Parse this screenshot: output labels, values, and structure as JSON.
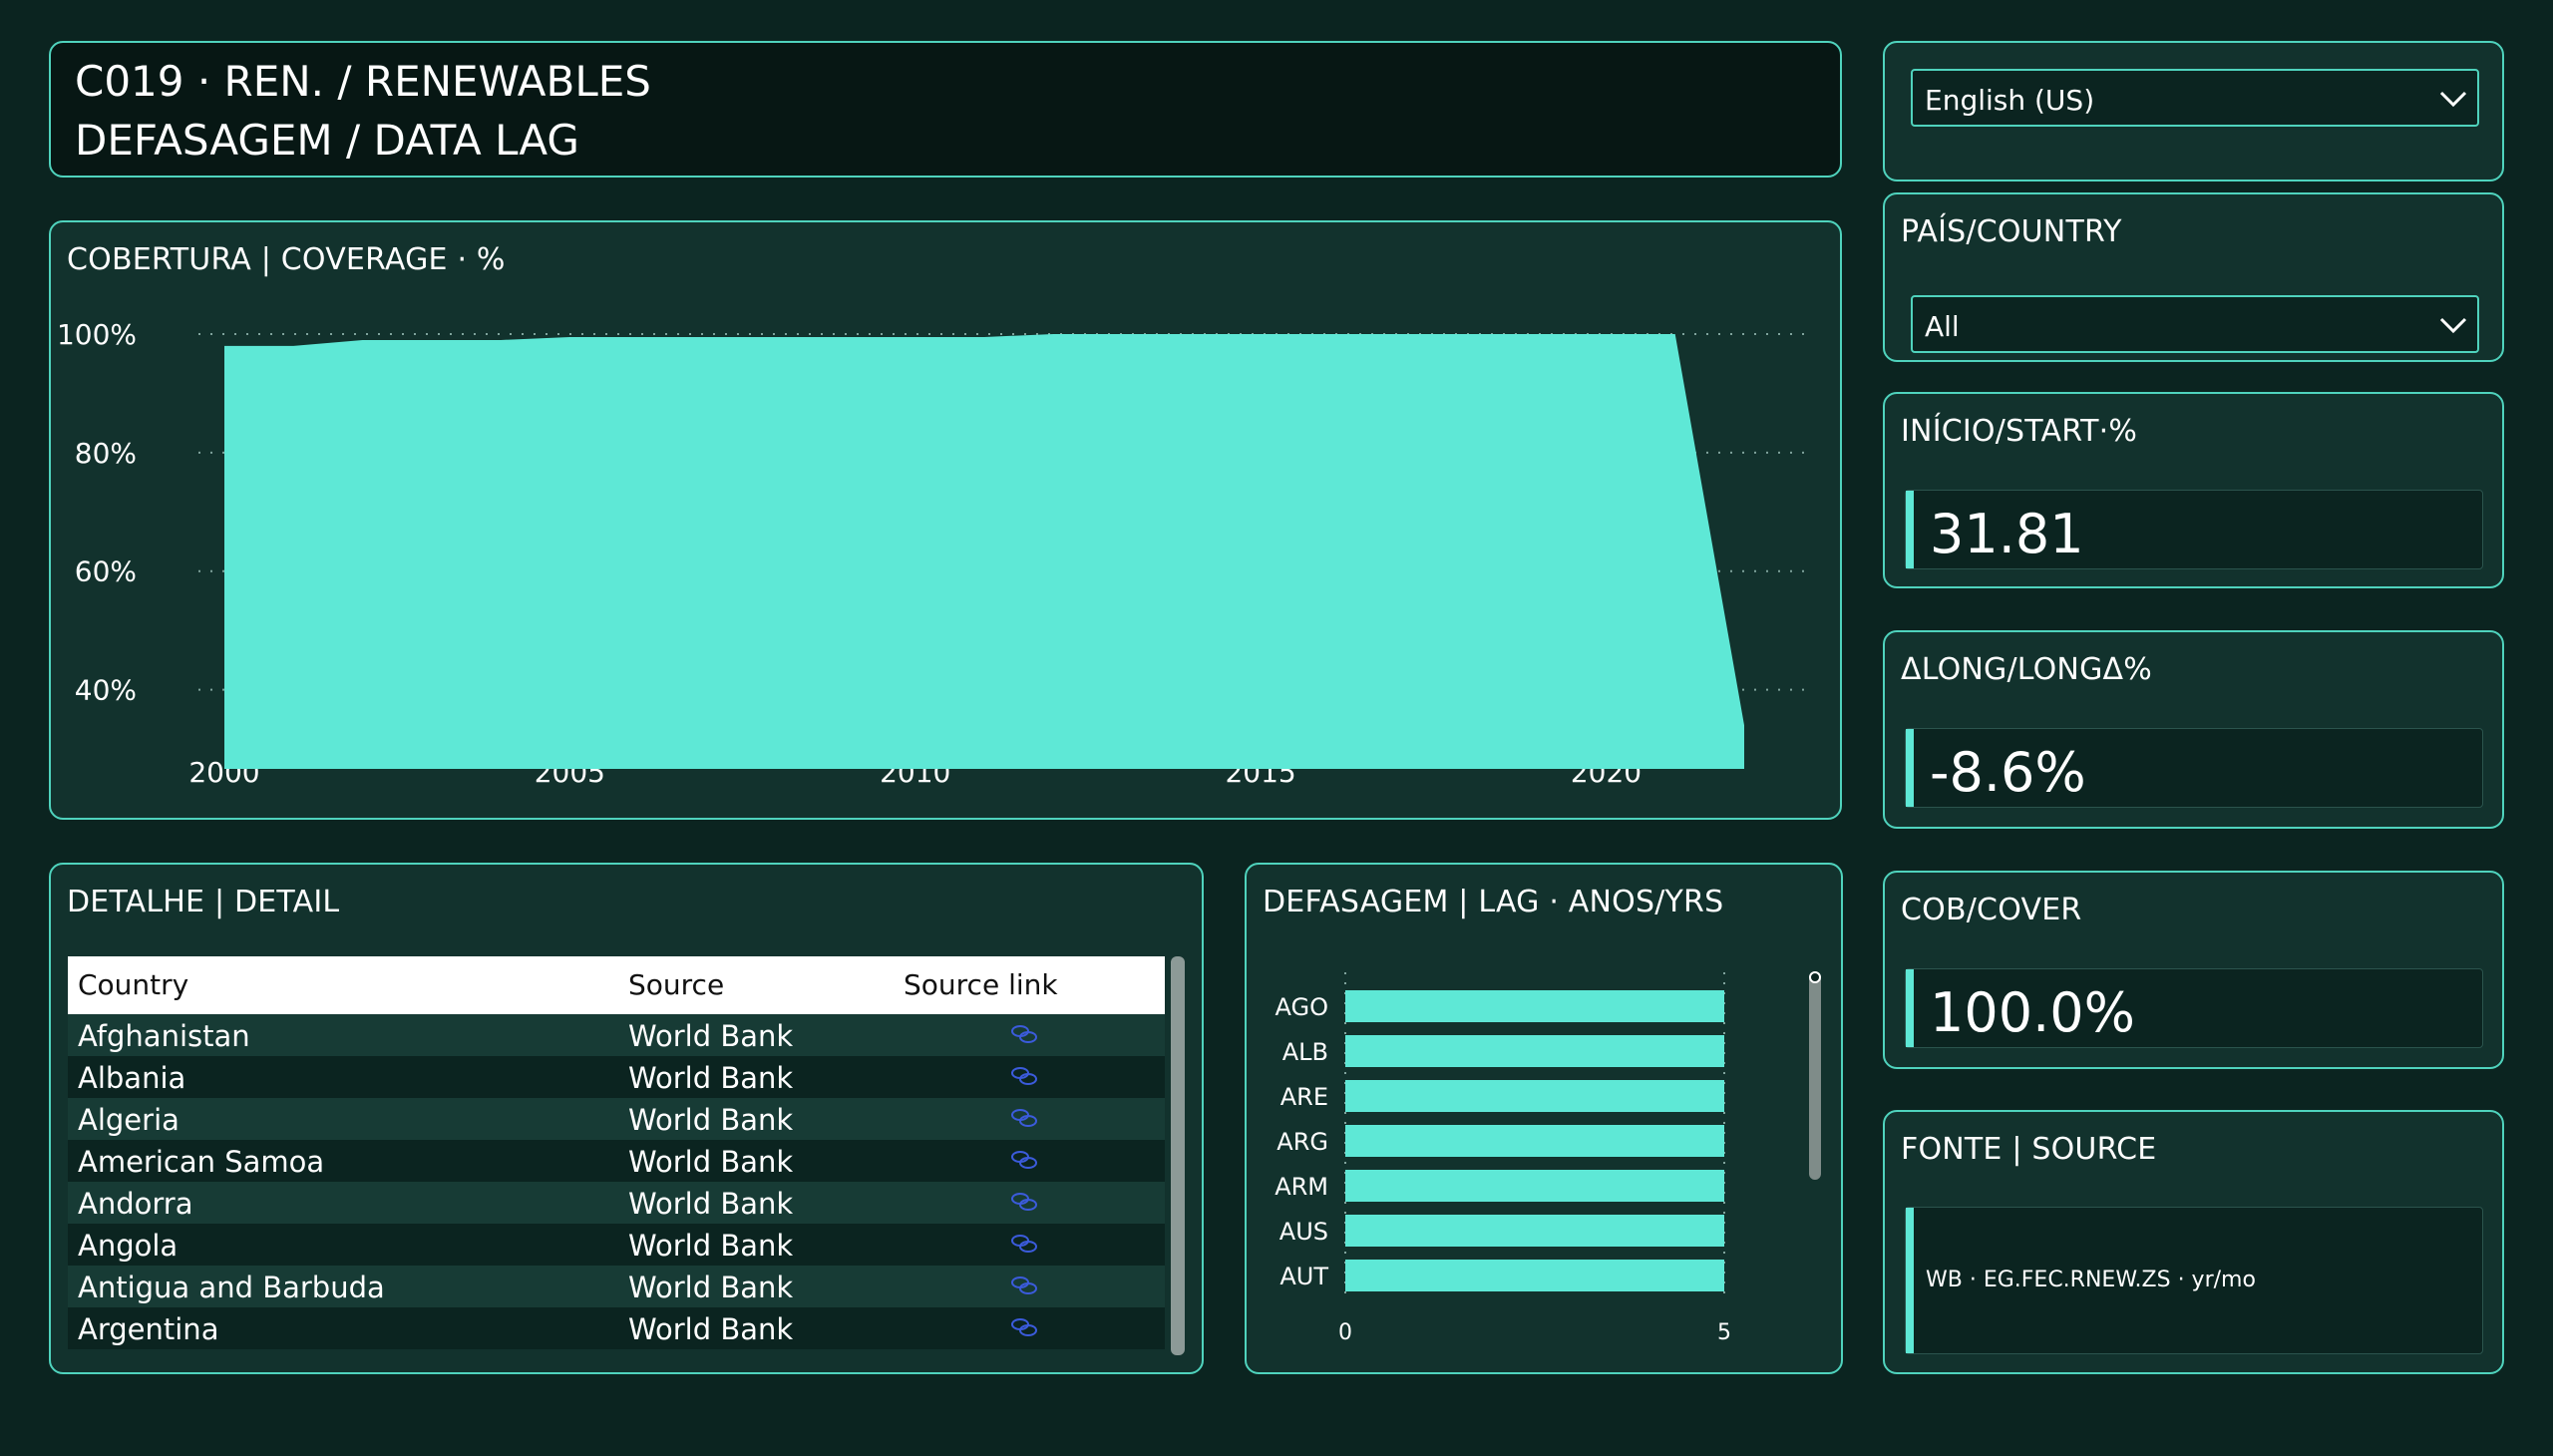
{
  "header": {
    "line1": "C019 · REN. / RENEWABLES",
    "line2": "DEFASAGEM / DATA LAG"
  },
  "language": {
    "selected": "English (US)"
  },
  "country_filter": {
    "title": "PAÍS/COUNTRY",
    "selected": "All"
  },
  "kpis": {
    "start": {
      "label": "INÍCIO/START·%",
      "value": "31.81"
    },
    "delta": {
      "label": "ΔLONG/LONGΔ%",
      "value": "-8.6%"
    },
    "cover": {
      "label": "COB/COVER",
      "value": "100.0%"
    },
    "source": {
      "label": "FONTE | SOURCE",
      "value": "WB · EG.FEC.RNEW.ZS · yr/mo"
    }
  },
  "coverage_chart_title": "COBERTURA | COVERAGE · %",
  "detail": {
    "title": "DETALHE | DETAIL",
    "columns": [
      "Country",
      "Source",
      "Source link"
    ],
    "rows": [
      {
        "country": "Afghanistan",
        "source": "World Bank"
      },
      {
        "country": "Albania",
        "source": "World Bank"
      },
      {
        "country": "Algeria",
        "source": "World Bank"
      },
      {
        "country": "American Samoa",
        "source": "World Bank"
      },
      {
        "country": "Andorra",
        "source": "World Bank"
      },
      {
        "country": "Angola",
        "source": "World Bank"
      },
      {
        "country": "Antigua and Barbuda",
        "source": "World Bank"
      },
      {
        "country": "Argentina",
        "source": "World Bank"
      }
    ]
  },
  "lag_chart_title": "DEFASAGEM | LAG · ANOS/YRS",
  "colors": {
    "accent": "#5ee8d6",
    "panel": "#12322d",
    "background": "#0b2420",
    "border": "#4fd3bd",
    "link": "#3b5bdb"
  },
  "chart_data": [
    {
      "type": "area",
      "title": "COBERTURA | COVERAGE · %",
      "x": [
        2000,
        2001,
        2002,
        2003,
        2004,
        2005,
        2006,
        2007,
        2008,
        2009,
        2010,
        2011,
        2012,
        2013,
        2014,
        2015,
        2016,
        2017,
        2018,
        2019,
        2020,
        2021,
        2022
      ],
      "values": [
        98,
        98,
        99,
        99,
        99,
        99.5,
        99.5,
        99.5,
        99.5,
        99.5,
        99.5,
        99.5,
        100,
        100,
        100,
        100,
        100,
        100,
        100,
        100,
        100,
        100,
        34
      ],
      "ylim": [
        30,
        100
      ],
      "yticks": [
        40,
        60,
        80,
        100
      ],
      "ytick_labels": [
        "40%",
        "60%",
        "80%",
        "100%"
      ],
      "xticks": [
        2000,
        2005,
        2010,
        2015,
        2020
      ],
      "grid": "horizontal dotted"
    },
    {
      "type": "bar",
      "orientation": "horizontal",
      "title": "DEFASAGEM | LAG · ANOS/YRS",
      "categories": [
        "AGO",
        "ALB",
        "ARE",
        "ARG",
        "ARM",
        "AUS",
        "AUT"
      ],
      "values": [
        5,
        5,
        5,
        5,
        5,
        5,
        5
      ],
      "xlim": [
        0,
        5
      ],
      "xticks": [
        0,
        5
      ]
    }
  ]
}
